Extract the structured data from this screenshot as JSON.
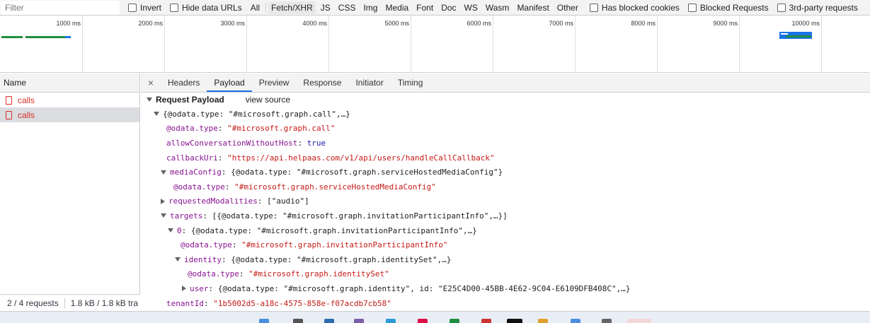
{
  "filterbar": {
    "placeholder": "Filter",
    "invert_label": "Invert",
    "hide_data_urls_label": "Hide data URLs",
    "types": [
      "All",
      "Fetch/XHR",
      "JS",
      "CSS",
      "Img",
      "Media",
      "Font",
      "Doc",
      "WS",
      "Wasm",
      "Manifest",
      "Other"
    ],
    "selected_type": "Fetch/XHR",
    "blocked_cookies_label": "Has blocked cookies",
    "blocked_requests_label": "Blocked Requests",
    "third_party_label": "3rd-party requests"
  },
  "overview": {
    "labels": [
      "1000 ms",
      "2000 ms",
      "3000 ms",
      "4000 ms",
      "5000 ms",
      "6000 ms",
      "7000 ms",
      "8000 ms",
      "9000 ms",
      "10000 ms"
    ]
  },
  "request_list": {
    "column": "Name",
    "rows": [
      {
        "name": "calls",
        "selected": false
      },
      {
        "name": "calls",
        "selected": true
      }
    ],
    "status_requests": "2 / 4 requests",
    "status_transfer": "1.8 kB / 1.8 kB tra"
  },
  "detail": {
    "close": "×",
    "tabs": [
      "Headers",
      "Payload",
      "Preview",
      "Response",
      "Initiator",
      "Timing"
    ],
    "active_tab": "Payload",
    "section_title": "Request Payload",
    "view_source": "view source",
    "tree": {
      "root_summary": "{@odata.type: \"#microsoft.graph.call\",…}",
      "odata_type_key": "@odata.type",
      "odata_type_val": "\"#microsoft.graph.call\"",
      "allow_key": "allowConversationWithoutHost",
      "allow_val": "true",
      "callback_key": "callbackUri",
      "callback_val": "\"https://api.helpaas.com/v1/api/users/handleCallCallback\"",
      "media_key": "mediaConfig",
      "media_summary": "{@odata.type: \"#microsoft.graph.serviceHostedMediaConfig\"}",
      "media_odata_key": "@odata.type",
      "media_odata_val": "\"#microsoft.graph.serviceHostedMediaConfig\"",
      "modalities_key": "requestedModalities",
      "modalities_summary": "[\"audio\"]",
      "targets_key": "targets",
      "targets_summary": "[{@odata.type: \"#microsoft.graph.invitationParticipantInfo\",…}]",
      "t0_key": "0",
      "t0_summary": "{@odata.type: \"#microsoft.graph.invitationParticipantInfo\",…}",
      "t0_odata_key": "@odata.type",
      "t0_odata_val": "\"#microsoft.graph.invitationParticipantInfo\"",
      "identity_key": "identity",
      "identity_summary": "{@odata.type: \"#microsoft.graph.identitySet\",…}",
      "identity_odata_key": "@odata.type",
      "identity_odata_val": "\"#microsoft.graph.identitySet\"",
      "user_key": "user",
      "user_summary": "{@odata.type: \"#microsoft.graph.identity\", id: \"E25C4D00-45BB-4E62-9C04-E6109DFB408C\",…}",
      "tenant_key": "tenantId",
      "tenant_val": "\"1b5002d5-a18c-4575-858e-f07acdb7cb58\""
    }
  },
  "colors": {
    "accent": "#1a73e8",
    "error_red": "#d93025",
    "key_purple": "#881391",
    "string_red": "#c41a16",
    "keyword_blue": "#1a1aa6"
  }
}
